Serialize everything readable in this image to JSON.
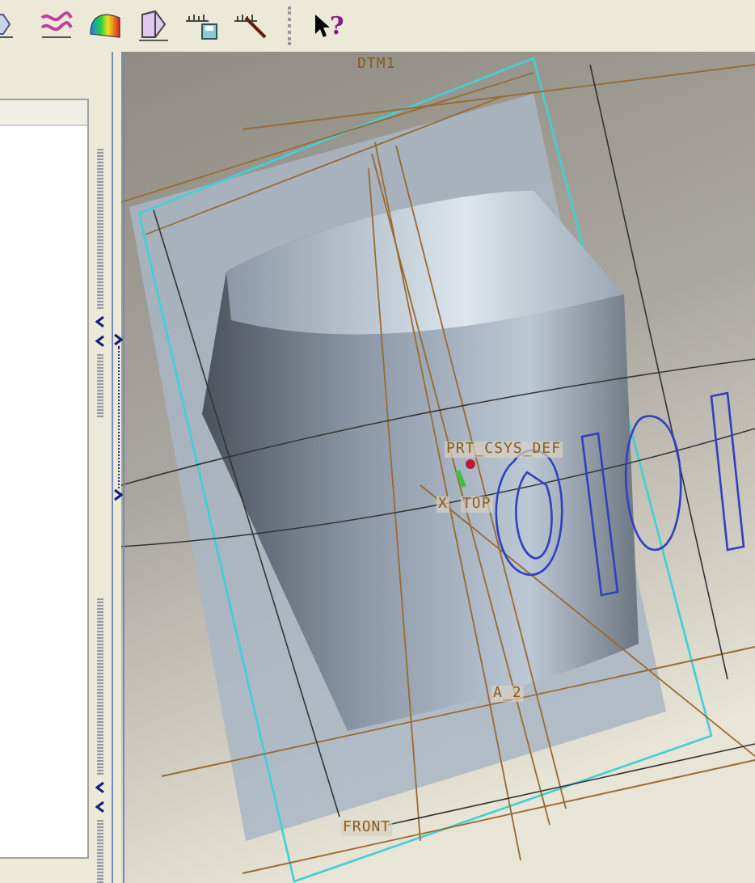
{
  "toolbar": [
    {
      "kind": "partial"
    },
    {
      "kind": "waves"
    },
    {
      "kind": "shade"
    },
    {
      "kind": "prism"
    },
    {
      "kind": "save-ruler"
    },
    {
      "kind": "ruler-off"
    },
    {
      "kind": "separator"
    },
    {
      "kind": "help",
      "glyph": "?"
    }
  ],
  "viewport": {
    "labels": [
      {
        "kind": "plane",
        "text": "DTM1"
      },
      {
        "kind": "csys",
        "text": "PRT_CSYS_DEF"
      },
      {
        "kind": "axis-x",
        "text": "X"
      },
      {
        "kind": "plane",
        "text": "TOP"
      },
      {
        "kind": "axis",
        "text": "A_2"
      },
      {
        "kind": "plane",
        "text": "FRONT"
      }
    ]
  }
}
